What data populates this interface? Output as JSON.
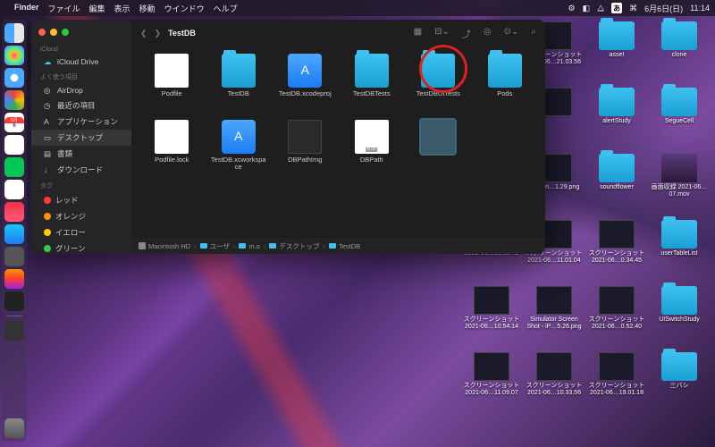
{
  "menubar": {
    "app": "Finder",
    "items": [
      "ファイル",
      "編集",
      "表示",
      "移動",
      "ウインドウ",
      "ヘルプ"
    ],
    "ime": "あ",
    "date": "6月6日(日)",
    "time": "11:14"
  },
  "dock": {
    "calendar_month": "6月",
    "calendar_day": "6"
  },
  "finder": {
    "window_title": "TestDB",
    "sidebar": {
      "sections": {
        "icloud": "iCloud",
        "favorites": "よく使う項目",
        "tags": "タグ"
      },
      "icloud_items": [
        {
          "label": "iCloud Drive",
          "icon": "cloud"
        }
      ],
      "favorite_items": [
        {
          "label": "AirDrop",
          "icon": "airdrop"
        },
        {
          "label": "最近の項目",
          "icon": "clock"
        },
        {
          "label": "アプリケーション",
          "icon": "apps"
        },
        {
          "label": "デスクトップ",
          "icon": "desktop",
          "active": true
        },
        {
          "label": "書類",
          "icon": "doc"
        },
        {
          "label": "ダウンロード",
          "icon": "download"
        }
      ],
      "tags": [
        {
          "label": "レッド",
          "color": "red"
        },
        {
          "label": "オレンジ",
          "color": "orange"
        },
        {
          "label": "イエロー",
          "color": "yellow"
        },
        {
          "label": "グリーン",
          "color": "green"
        }
      ]
    },
    "files": [
      {
        "name": "Podfile",
        "type": "doc"
      },
      {
        "name": "TestDB",
        "type": "folder"
      },
      {
        "name": "TestDB.xcodeproj",
        "type": "xcode"
      },
      {
        "name": "TestDBTests",
        "type": "folder"
      },
      {
        "name": "TestDBUITests",
        "type": "folder"
      },
      {
        "name": "Pods",
        "type": "folder",
        "circled": true
      },
      {
        "name": "Podfile.lock",
        "type": "doc"
      },
      {
        "name": "TestDB.xcworkspace",
        "type": "xcode"
      },
      {
        "name": "DBPathImg",
        "type": "doc-dark"
      },
      {
        "name": "DBPath",
        "type": "rtf"
      },
      {
        "name": "",
        "type": "selected-blank"
      }
    ],
    "pathbar": [
      "Macintosh HD",
      "ユーザ",
      "m.o",
      "デスクトップ",
      "TestDB"
    ]
  },
  "desktop": {
    "items": [
      {
        "label": "clone",
        "type": "folder"
      },
      {
        "label": "asset",
        "type": "folder"
      },
      {
        "label": "スクリーンショット 2021-06…21.03.56",
        "type": "img"
      },
      {
        "label": "",
        "type": "img"
      },
      {
        "label": "SegueCell",
        "type": "folder"
      },
      {
        "label": "alertStudy",
        "type": "folder"
      },
      {
        "label": "",
        "type": "img"
      },
      {
        "label": "",
        "type": "img"
      },
      {
        "label": "画面収録 2021-06…07.mov",
        "type": "mov"
      },
      {
        "label": "soundflower",
        "type": "folder"
      },
      {
        "label": "Screen…1.29.png",
        "type": "img"
      },
      {
        "label": "",
        "type": "img"
      },
      {
        "label": "userTableList",
        "type": "folder"
      },
      {
        "label": "スクリーンショット 2021-06…0.34.45",
        "type": "img"
      },
      {
        "label": "スクリーンショット 2021-06…11.01.04",
        "type": "img"
      },
      {
        "label": "2021-06…10.52.41",
        "type": "img"
      },
      {
        "label": "UISwitchStudy",
        "type": "folder"
      },
      {
        "label": "スクリーンショット 2021-06…0.52.40",
        "type": "img"
      },
      {
        "label": "Simulator Screen Shot - iP…5.26.png",
        "type": "img"
      },
      {
        "label": "スクリーンショット 2021-06…10.54.14",
        "type": "img"
      },
      {
        "label": "三バシ",
        "type": "folder"
      },
      {
        "label": "スクリーンショット 2021-06…19.01.18",
        "type": "img"
      },
      {
        "label": "スクリーンショット 2021-06…10.33.56",
        "type": "img"
      },
      {
        "label": "スクリーンショット 2021-06…11.09.07",
        "type": "img"
      }
    ]
  }
}
